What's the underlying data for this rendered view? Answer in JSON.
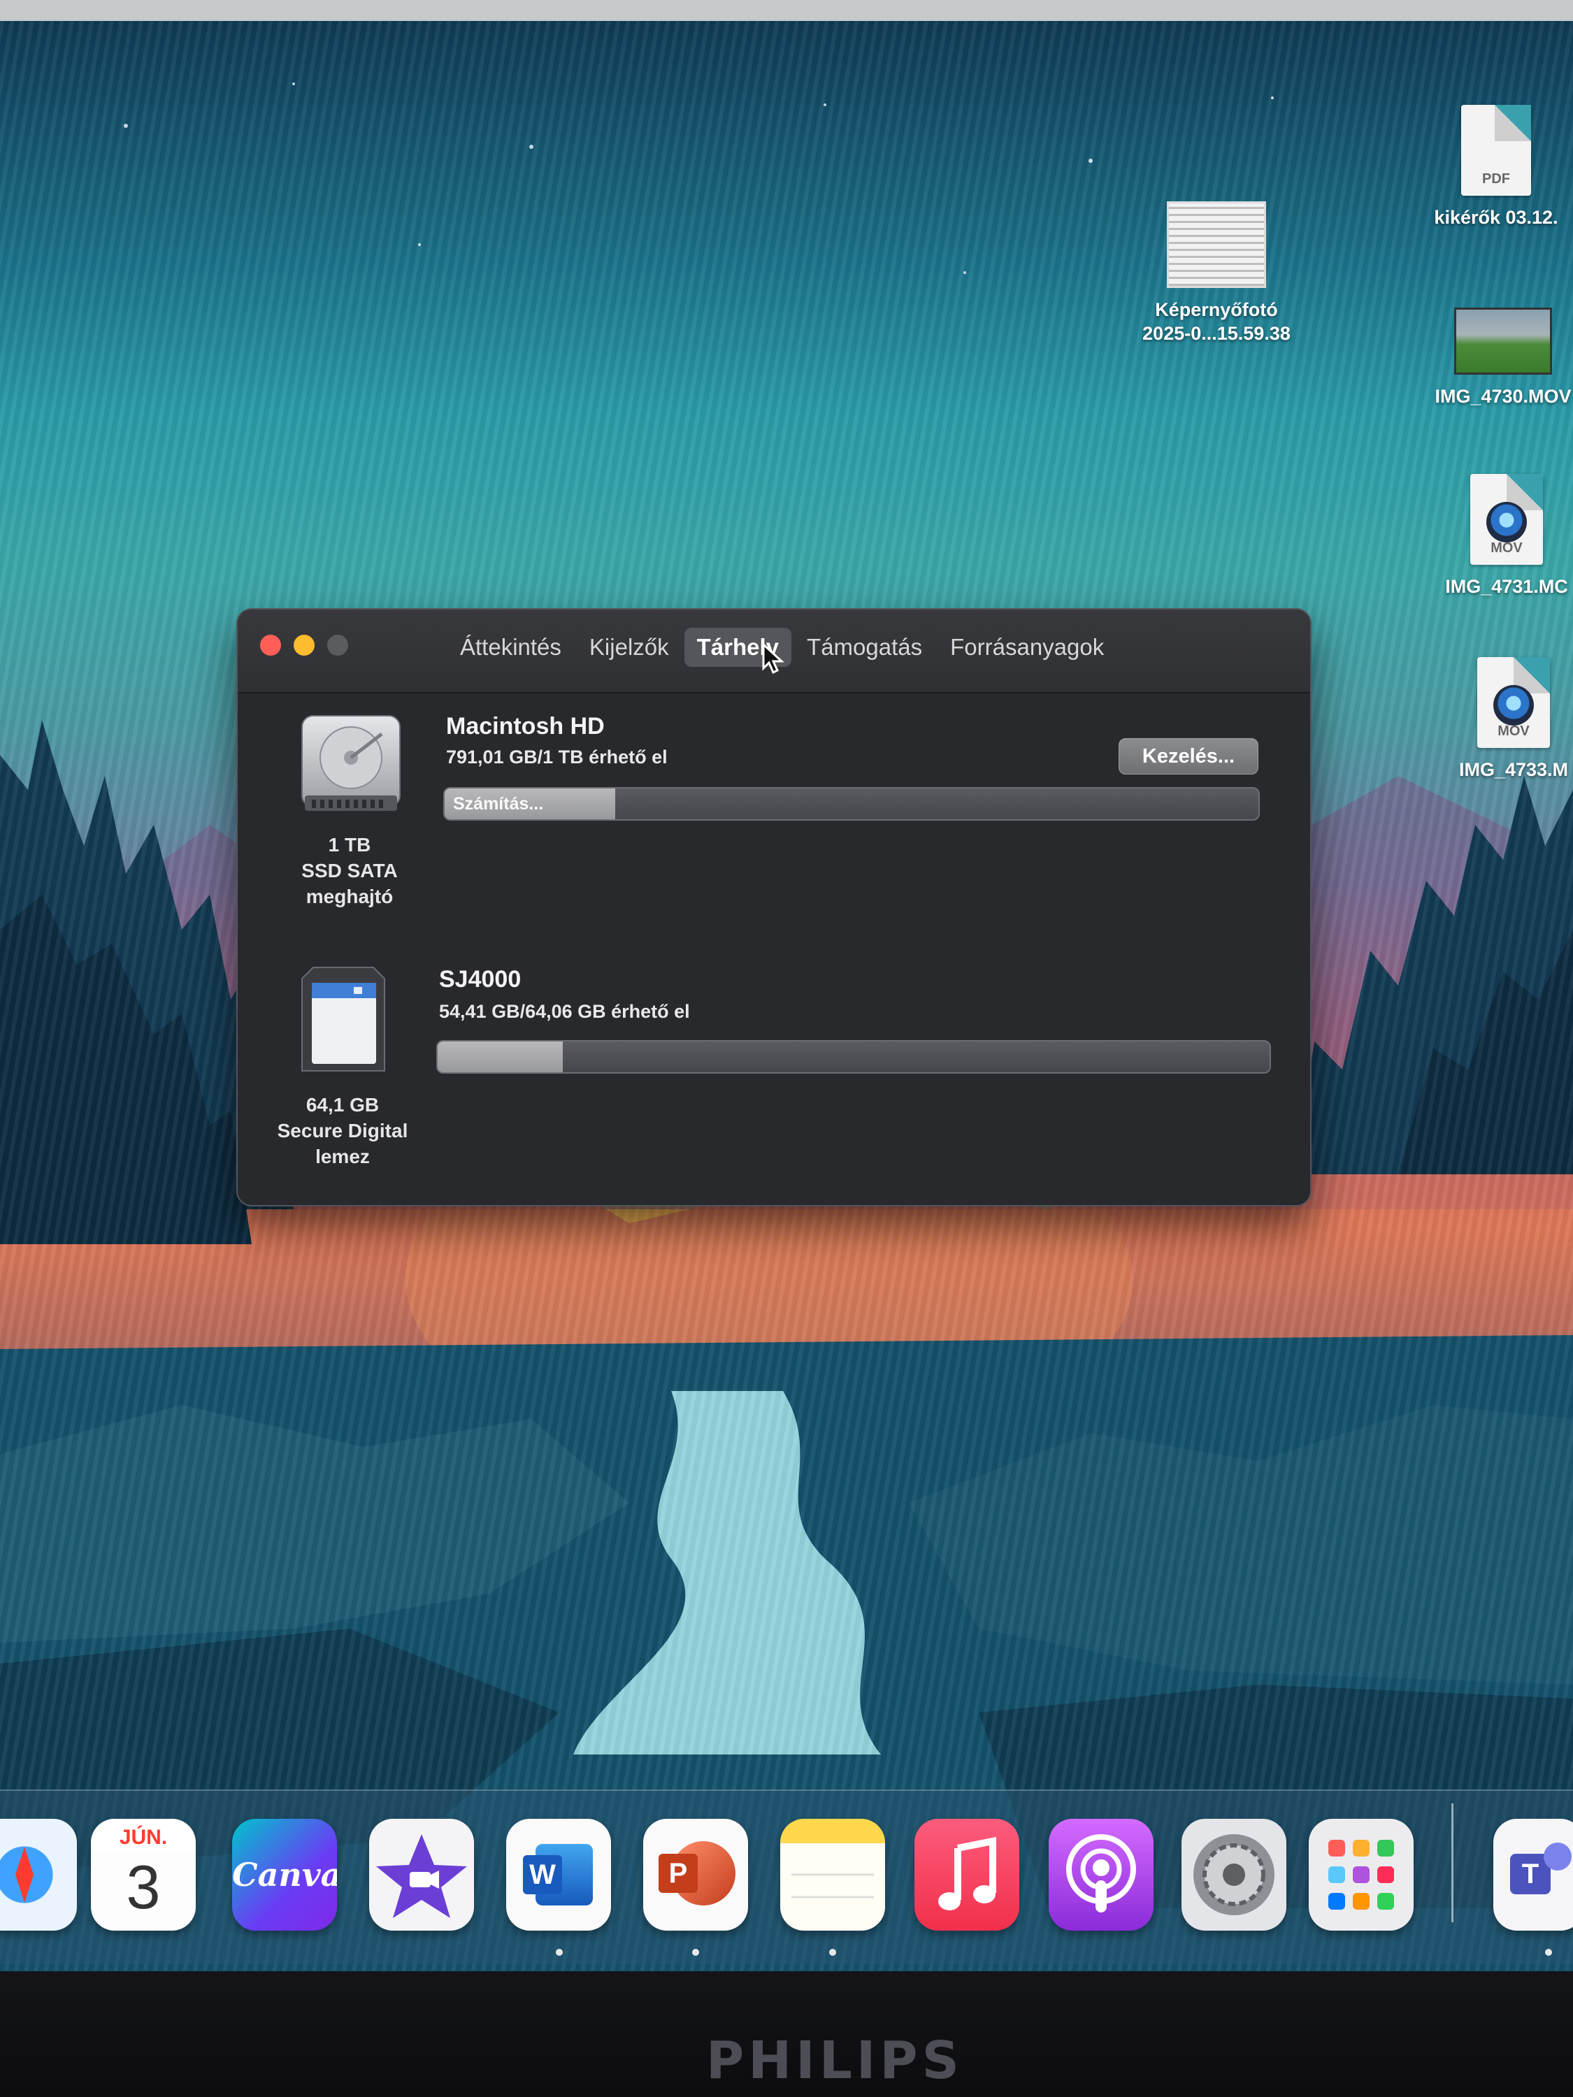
{
  "desktop": {
    "icons": [
      {
        "label": "kikérők 03.12.",
        "ext": "PDF"
      },
      {
        "label_line1": "Képernyőfotó",
        "label_line2": "2025-0...15.59.38"
      },
      {
        "label": "IMG_4730.MOV"
      },
      {
        "label": "IMG_4731.MC",
        "ext": "MOV"
      },
      {
        "label": "IMG_4733.M",
        "ext": "MOV"
      }
    ]
  },
  "window": {
    "tabs": [
      "Áttekintés",
      "Kijelzők",
      "Tárhely",
      "Támogatás",
      "Forrásanyagok"
    ],
    "active_tab": "Tárhely",
    "manage_label": "Kezelés...",
    "drives": [
      {
        "name": "Macintosh HD",
        "available": "791,01 GB/1 TB érhető el",
        "bar_text": "Számítás...",
        "used_fraction": 0.21,
        "caption": [
          "1 TB",
          "SSD SATA",
          "meghajtó"
        ]
      },
      {
        "name": "SJ4000",
        "available": "54,41 GB/64,06 GB érhető el",
        "bar_text": "",
        "used_fraction": 0.15,
        "caption": [
          "64,1 GB",
          "Secure Digital",
          "lemez"
        ]
      }
    ]
  },
  "dock": {
    "calendar": {
      "month": "JÚN.",
      "day": "3"
    },
    "canva_label": "Canva",
    "word_letter": "W",
    "powerpoint_letter": "P",
    "teams_letter": "T"
  },
  "monitor_brand": "PHILIPS",
  "colors": {
    "close": "#ff5f57",
    "minimize": "#febc2e",
    "zoom": "#5b5c60"
  }
}
